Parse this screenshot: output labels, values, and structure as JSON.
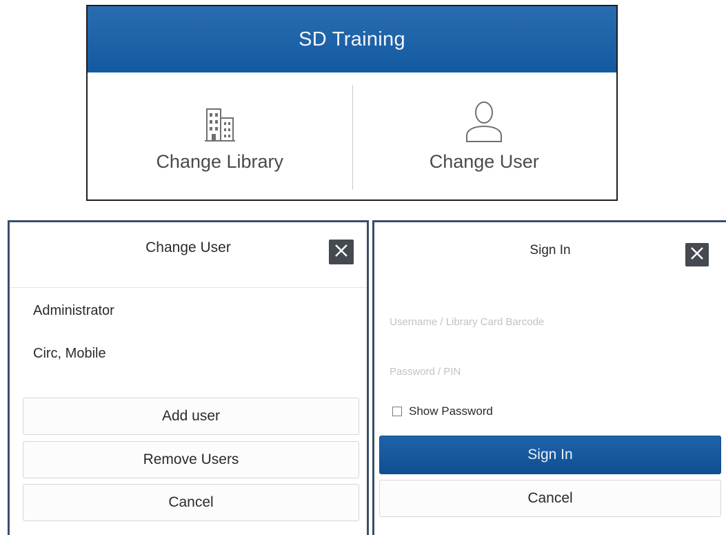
{
  "library_panel": {
    "title": "SD Training",
    "change_library_label": "Change Library",
    "change_user_label": "Change User",
    "header_color": "#1a62a8"
  },
  "change_user_dialog": {
    "title": "Change User",
    "users": [
      "Administrator",
      "Circ, Mobile"
    ],
    "add_user_label": "Add user",
    "remove_users_label": "Remove Users",
    "cancel_label": "Cancel"
  },
  "sign_in_dialog": {
    "title": "Sign In",
    "username_placeholder": "Username / Library Card Barcode",
    "password_placeholder": "Password / PIN",
    "show_password_label": "Show Password",
    "show_password_checked": false,
    "sign_in_label": "Sign In",
    "cancel_label": "Cancel"
  },
  "icons": {
    "library": "building-icon",
    "user": "user-icon",
    "close": "close-icon"
  }
}
